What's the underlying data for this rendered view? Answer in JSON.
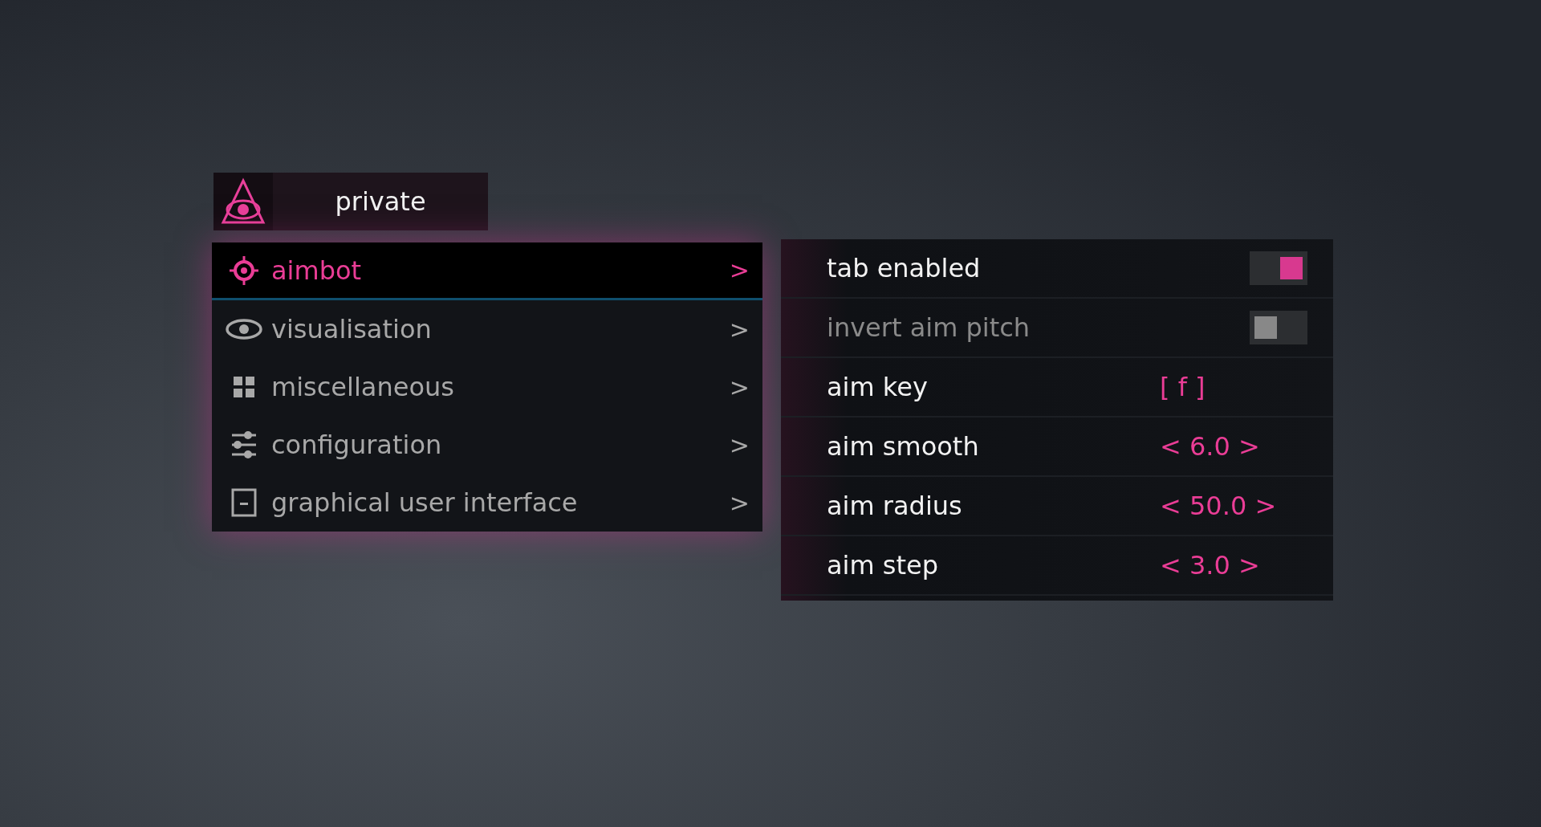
{
  "header": {
    "title": "private"
  },
  "menu": [
    {
      "label": "aimbot",
      "arrow": ">",
      "selected": true
    },
    {
      "label": "visualisation",
      "arrow": ">",
      "selected": false
    },
    {
      "label": "miscellaneous",
      "arrow": ">",
      "selected": false
    },
    {
      "label": "configuration",
      "arrow": ">",
      "selected": false
    },
    {
      "label": "graphical user interface",
      "arrow": ">",
      "selected": false
    }
  ],
  "options": [
    {
      "kind": "toggle",
      "label": "tab enabled",
      "checked": true
    },
    {
      "kind": "toggle",
      "label": "invert aim pitch",
      "checked": false
    },
    {
      "kind": "key",
      "label": "aim key",
      "value": "[ f ]"
    },
    {
      "kind": "stepper",
      "label": "aim smooth",
      "value": "< 6.0 >"
    },
    {
      "kind": "stepper",
      "label": "aim radius",
      "value": "< 50.0 >"
    },
    {
      "kind": "stepper",
      "label": "aim step",
      "value": "< 3.0 >"
    }
  ]
}
